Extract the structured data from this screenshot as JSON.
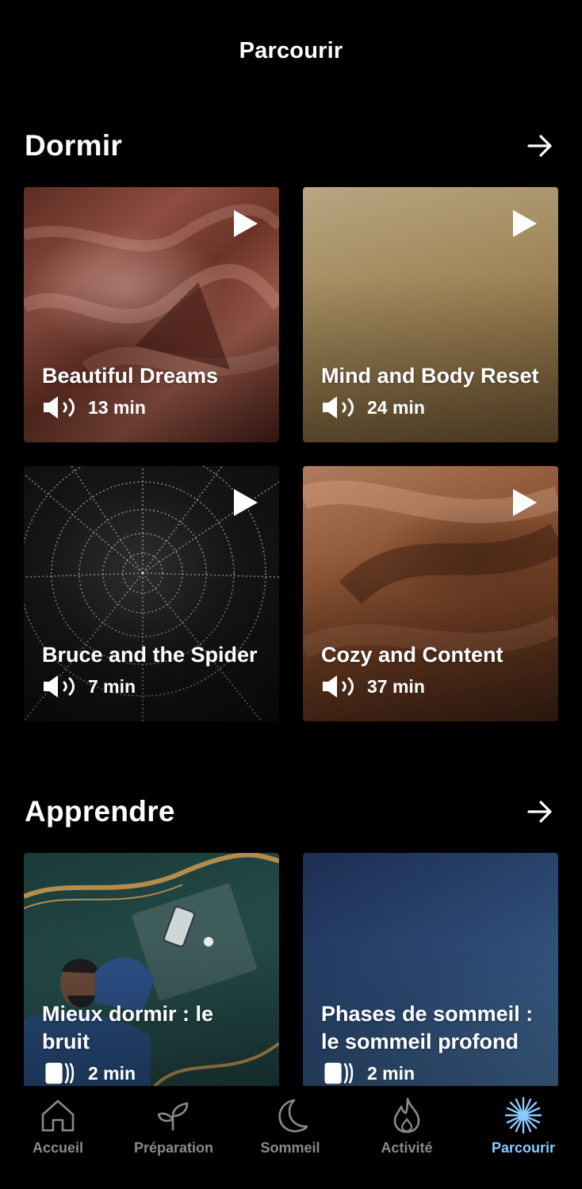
{
  "header": {
    "title": "Parcourir"
  },
  "sections": [
    {
      "title": "Dormir",
      "cards": [
        {
          "title": "Beautiful Dreams",
          "duration": "13 min"
        },
        {
          "title": "Mind and Body Reset",
          "duration": "24 min"
        },
        {
          "title": "Bruce and the Spider",
          "duration": "7 min"
        },
        {
          "title": "Cozy and Content",
          "duration": "37 min"
        }
      ]
    },
    {
      "title": "Apprendre",
      "cards": [
        {
          "title": "Mieux dormir : le bruit",
          "duration": "2 min"
        },
        {
          "title": "Phases de sommeil : le sommeil profond",
          "duration": "2 min"
        }
      ]
    }
  ],
  "nav": {
    "items": [
      {
        "label": "Accueil",
        "icon": "home-icon"
      },
      {
        "label": "Préparation",
        "icon": "sprout-icon"
      },
      {
        "label": "Sommeil",
        "icon": "moon-icon"
      },
      {
        "label": "Activité",
        "icon": "flame-icon"
      },
      {
        "label": "Parcourir",
        "icon": "sparkle-icon",
        "active": true
      }
    ]
  },
  "colors": {
    "background": "#000000",
    "active_tab": "#8ec9ff",
    "inactive_tab": "#8a8a8a"
  }
}
